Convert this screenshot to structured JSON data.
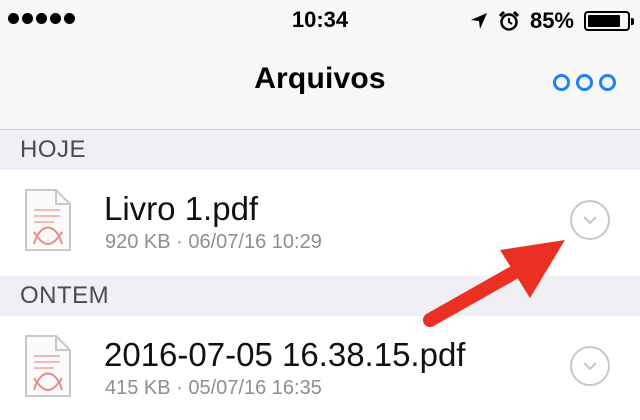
{
  "status_bar": {
    "time": "10:34",
    "battery_pct": "85%",
    "battery_level": 0.85,
    "signal_bars": 5,
    "icons": [
      "signal-icon",
      "location-arrow-icon",
      "alarm-clock-icon",
      "battery-icon"
    ]
  },
  "nav": {
    "title": "Arquivos",
    "more_icon": "ellipsis-icon"
  },
  "sections": [
    {
      "header": "HOJE",
      "files": [
        {
          "name": "Livro 1.pdf",
          "meta": "920 KB · 06/07/16 10:29",
          "icon": "pdf-file-icon"
        }
      ]
    },
    {
      "header": "ONTEM",
      "files": [
        {
          "name": "2016-07-05 16.38.15.pdf",
          "meta": "415 KB · 05/07/16 16:35",
          "icon": "pdf-file-icon"
        }
      ]
    }
  ],
  "colors": {
    "accent": "#1a82fb",
    "annotation_arrow": "#ec2f23",
    "section_bg": "#efeff4",
    "secondary_text": "#8e8e93"
  }
}
